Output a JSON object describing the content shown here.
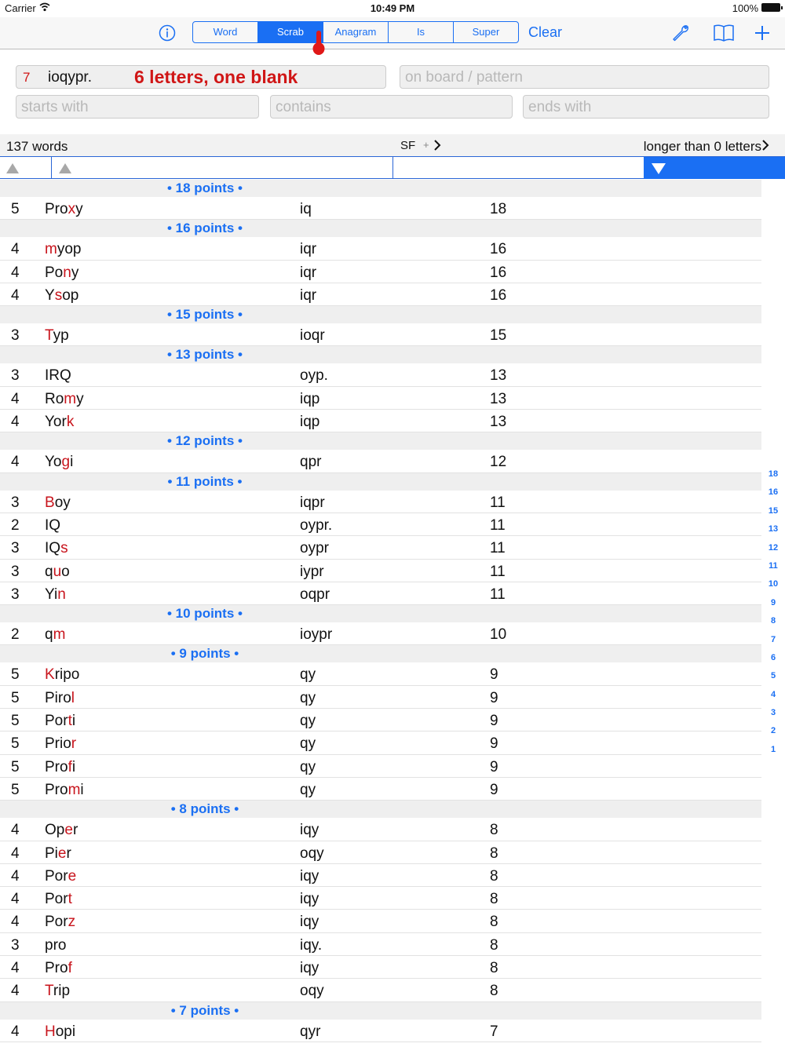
{
  "status": {
    "carrier": "Carrier",
    "time": "10:49 PM",
    "battery": "100%"
  },
  "toolbar": {
    "segments": [
      "Word",
      "Scrab",
      "Anagram",
      "Is",
      "Super"
    ],
    "active_segment": "Scrab",
    "clear_label": "Clear",
    "icons": [
      "info-icon",
      "wrench-icon",
      "book-icon",
      "plus-icon"
    ]
  },
  "search": {
    "letter_count": "7",
    "letters_value": "ioqypr.",
    "letters_hint": "6 letters, one blank",
    "board_placeholder": "on board / pattern",
    "starts_placeholder": "starts with",
    "contains_placeholder": "contains",
    "ends_placeholder": "ends with"
  },
  "summary": {
    "count": "137 words",
    "sort_label": "SF",
    "sort_sub": "+",
    "length_filter": "longer than 0 letters"
  },
  "accent_color": "#1a6ff3",
  "highlight_color": "#c8141c",
  "groups": [
    {
      "header": "• 18 points •",
      "rows": [
        {
          "len": "5",
          "pre": "Pro",
          "hl": "x",
          "post": "y",
          "left": "iq",
          "pts": "18"
        }
      ]
    },
    {
      "header": "• 16 points •",
      "rows": [
        {
          "len": "4",
          "pre": "",
          "hl": "m",
          "post": "yop",
          "left": "iqr",
          "pts": "16"
        },
        {
          "len": "4",
          "pre": "Po",
          "hl": "n",
          "post": "y",
          "left": "iqr",
          "pts": "16"
        },
        {
          "len": "4",
          "pre": "Y",
          "hl": "s",
          "post": "op",
          "left": "iqr",
          "pts": "16"
        }
      ]
    },
    {
      "header": "• 15 points •",
      "rows": [
        {
          "len": "3",
          "pre": "",
          "hl": "T",
          "post": "yp",
          "left": "ioqr",
          "pts": "15"
        }
      ]
    },
    {
      "header": "• 13 points •",
      "rows": [
        {
          "len": "3",
          "pre": "IRQ",
          "hl": "",
          "post": "",
          "left": "oyp.",
          "pts": "13"
        },
        {
          "len": "4",
          "pre": "Ro",
          "hl": "m",
          "post": "y",
          "left": "iqp",
          "pts": "13"
        },
        {
          "len": "4",
          "pre": "Yor",
          "hl": "k",
          "post": "",
          "left": "iqp",
          "pts": "13"
        }
      ]
    },
    {
      "header": "• 12 points •",
      "rows": [
        {
          "len": "4",
          "pre": "Yo",
          "hl": "g",
          "post": "i",
          "left": "qpr",
          "pts": "12"
        }
      ]
    },
    {
      "header": "• 11 points •",
      "rows": [
        {
          "len": "3",
          "pre": "",
          "hl": "B",
          "post": "oy",
          "left": "iqpr",
          "pts": "11"
        },
        {
          "len": "2",
          "pre": "IQ",
          "hl": "",
          "post": "",
          "left": "oypr.",
          "pts": "11"
        },
        {
          "len": "3",
          "pre": "IQ",
          "hl": "s",
          "post": "",
          "left": "oypr",
          "pts": "11"
        },
        {
          "len": "3",
          "pre": "q",
          "hl": "u",
          "post": "o",
          "left": "iypr",
          "pts": "11"
        },
        {
          "len": "3",
          "pre": "Yi",
          "hl": "n",
          "post": "",
          "left": "oqpr",
          "pts": "11"
        }
      ]
    },
    {
      "header": "• 10 points •",
      "rows": [
        {
          "len": "2",
          "pre": "q",
          "hl": "m",
          "post": "",
          "left": "ioypr",
          "pts": "10"
        }
      ]
    },
    {
      "header": "• 9 points •",
      "rows": [
        {
          "len": "5",
          "pre": "",
          "hl": "K",
          "post": "ripo",
          "left": "qy",
          "pts": "9"
        },
        {
          "len": "5",
          "pre": "Piro",
          "hl": "l",
          "post": "",
          "left": "qy",
          "pts": "9"
        },
        {
          "len": "5",
          "pre": "Por",
          "hl": "t",
          "post": "i",
          "left": "qy",
          "pts": "9"
        },
        {
          "len": "5",
          "pre": "Prio",
          "hl": "r",
          "post": "",
          "left": "qy",
          "pts": "9"
        },
        {
          "len": "5",
          "pre": "Pro",
          "hl": "f",
          "post": "i",
          "left": "qy",
          "pts": "9"
        },
        {
          "len": "5",
          "pre": "Pro",
          "hl": "m",
          "post": "i",
          "left": "qy",
          "pts": "9"
        }
      ]
    },
    {
      "header": "• 8 points •",
      "rows": [
        {
          "len": "4",
          "pre": "Op",
          "hl": "e",
          "post": "r",
          "left": "iqy",
          "pts": "8"
        },
        {
          "len": "4",
          "pre": "Pi",
          "hl": "e",
          "post": "r",
          "left": "oqy",
          "pts": "8"
        },
        {
          "len": "4",
          "pre": "Por",
          "hl": "e",
          "post": "",
          "left": "iqy",
          "pts": "8"
        },
        {
          "len": "4",
          "pre": "Por",
          "hl": "t",
          "post": "",
          "left": "iqy",
          "pts": "8"
        },
        {
          "len": "4",
          "pre": "Por",
          "hl": "z",
          "post": "",
          "left": "iqy",
          "pts": "8"
        },
        {
          "len": "3",
          "pre": "pro",
          "hl": "",
          "post": "",
          "left": "iqy.",
          "pts": "8"
        },
        {
          "len": "4",
          "pre": "Pro",
          "hl": "f",
          "post": "",
          "left": "iqy",
          "pts": "8"
        },
        {
          "len": "4",
          "pre": "",
          "hl": "T",
          "post": "rip",
          "left": "oqy",
          "pts": "8"
        }
      ]
    },
    {
      "header": "• 7 points •",
      "rows": [
        {
          "len": "4",
          "pre": "",
          "hl": "H",
          "post": "opi",
          "left": "qyr",
          "pts": "7"
        }
      ]
    }
  ],
  "index": [
    "18",
    "16",
    "15",
    "13",
    "12",
    "11",
    "10",
    "9",
    "8",
    "7",
    "6",
    "5",
    "4",
    "3",
    "2",
    "1"
  ]
}
